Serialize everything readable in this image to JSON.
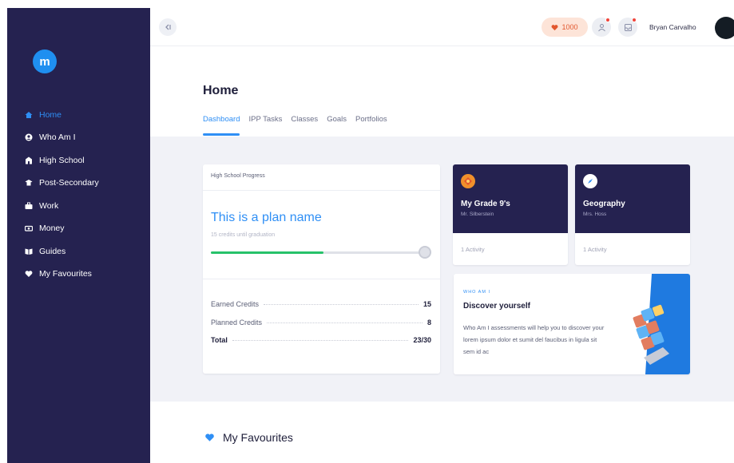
{
  "sidebar": {
    "logo": "m",
    "items": [
      {
        "label": "Home",
        "icon": "home-icon"
      },
      {
        "label": "Who Am I",
        "icon": "user-icon"
      },
      {
        "label": "High School",
        "icon": "school-icon"
      },
      {
        "label": "Post-Secondary",
        "icon": "grad-icon"
      },
      {
        "label": "Work",
        "icon": "briefcase-icon"
      },
      {
        "label": "Money",
        "icon": "money-icon"
      },
      {
        "label": "Guides",
        "icon": "book-icon"
      },
      {
        "label": "My Favourites",
        "icon": "heart-icon"
      }
    ]
  },
  "topbar": {
    "heart_count": "1000",
    "user_name": "Bryan Carvalho"
  },
  "page": {
    "title": "Home",
    "tabs": [
      "Dashboard",
      "IPP Tasks",
      "Classes",
      "Goals",
      "Portfolios"
    ]
  },
  "progress_card": {
    "header": "High School Progress",
    "plan_name": "This is a plan name",
    "subtitle": "15 credits until graduation",
    "progress_fraction": 0.53,
    "rows": [
      {
        "label": "Earned Credits",
        "value": "15"
      },
      {
        "label": "Planned Credits",
        "value": "8"
      },
      {
        "label": "Total",
        "value": "23/30"
      }
    ]
  },
  "classes": [
    {
      "title": "My Grade 9's",
      "teacher": "Mr. Silberstein",
      "activity": "1 Activity",
      "icon": "class-badge-icon"
    },
    {
      "title": "Geography",
      "teacher": "Mrs. Hoss",
      "activity": "1 Activity",
      "icon": "compass-icon"
    }
  ],
  "discover": {
    "kicker": "WHO AM I",
    "title": "Discover yourself",
    "body": "Who Am I assessments will help you to discover your lorem ipsum dolor et sumit del faucibus in ligula sit sem id ac"
  },
  "favourites": {
    "title": "My Favourites"
  },
  "colors": {
    "sidebar_bg": "#252250",
    "accent": "#2f8ff5",
    "progress_green": "#27c26a",
    "band_bg": "#f1f2f7"
  }
}
